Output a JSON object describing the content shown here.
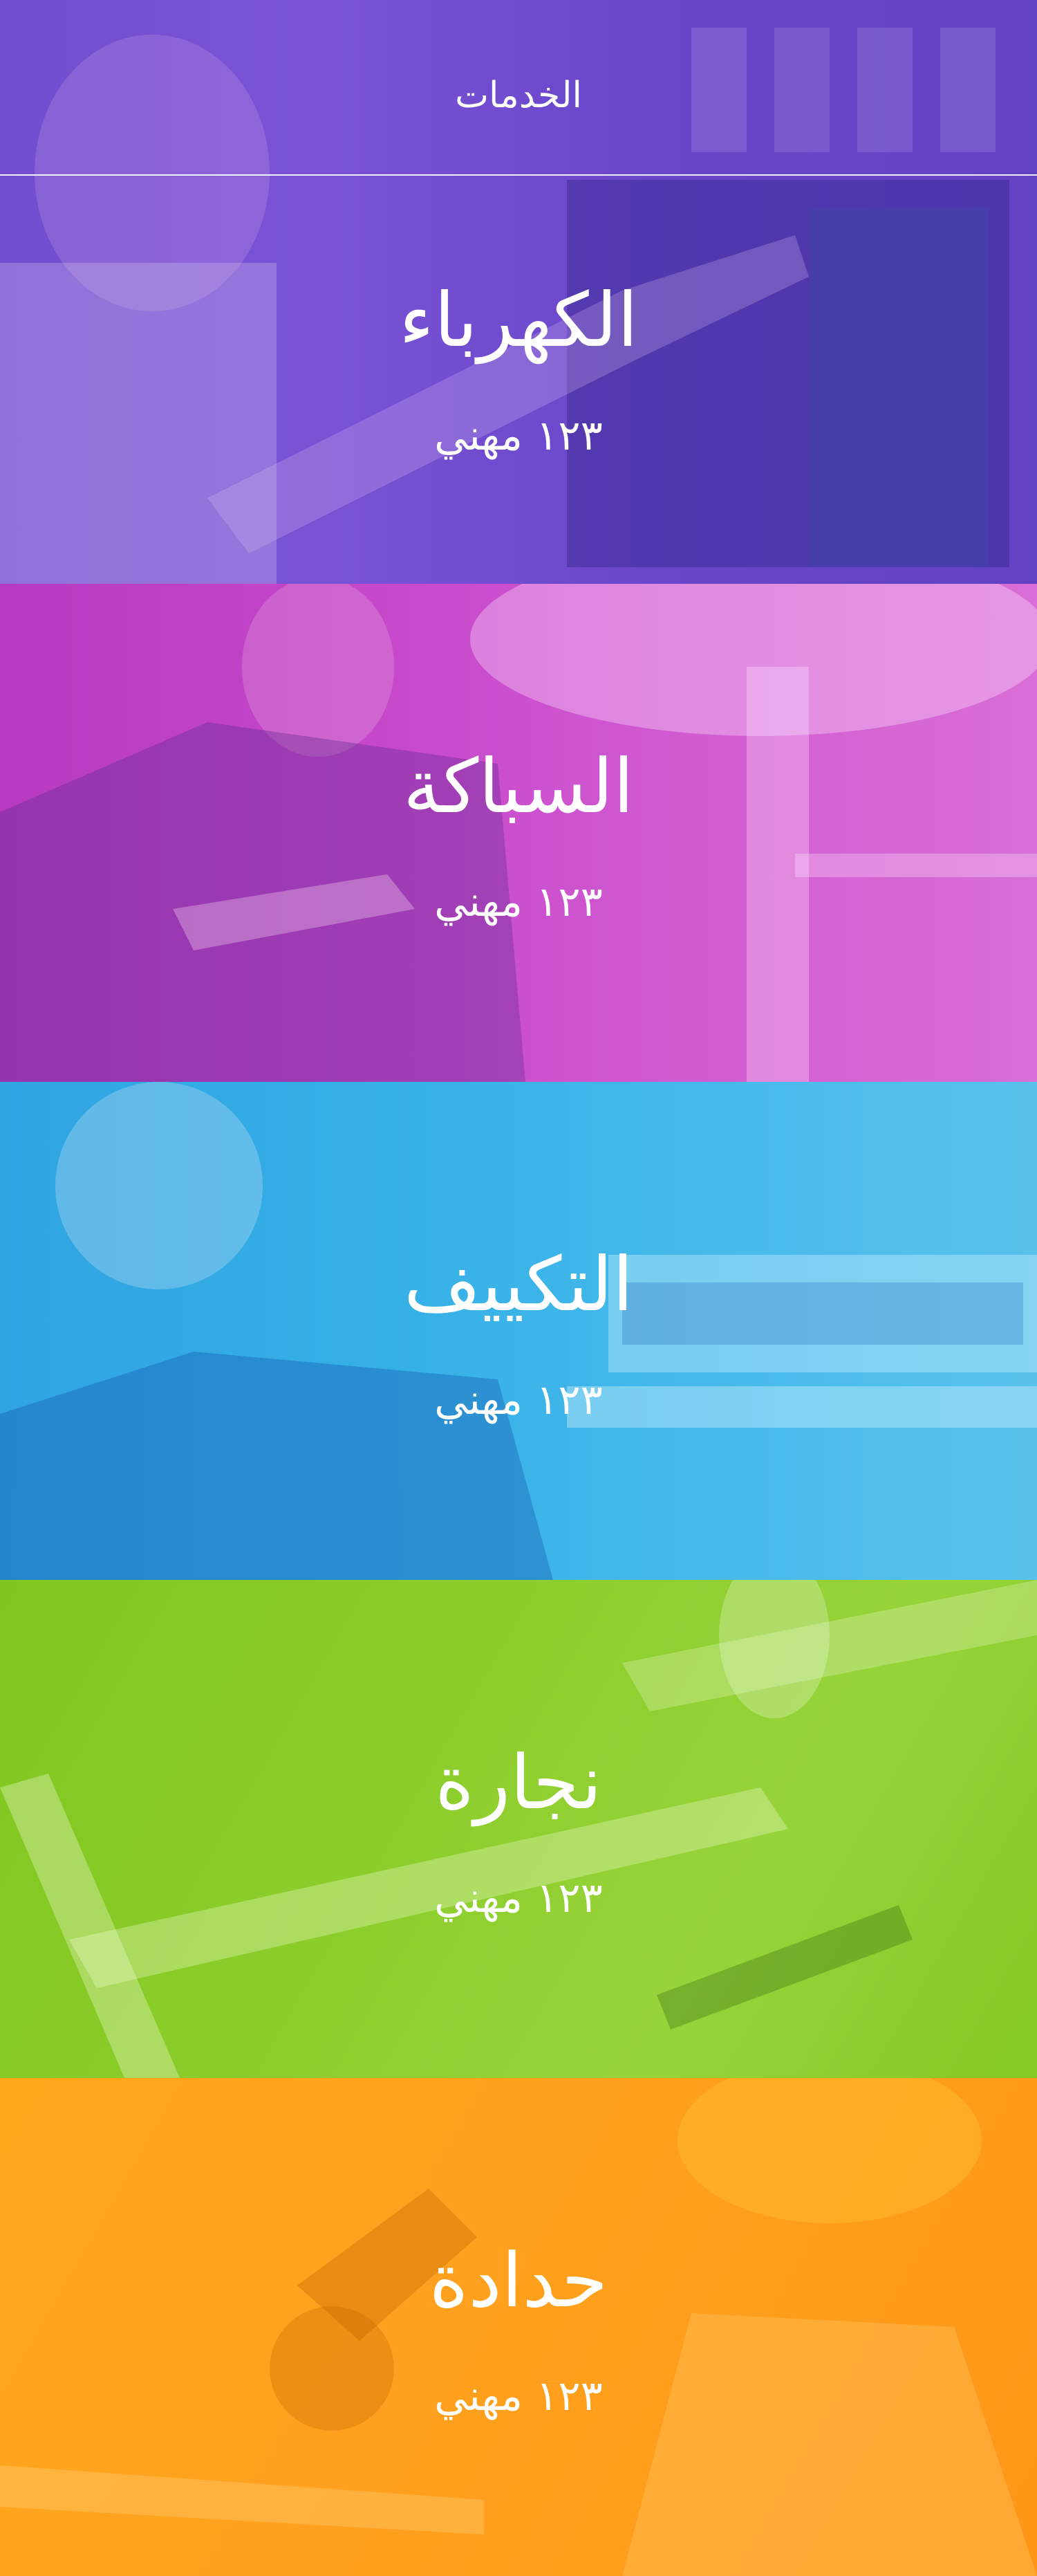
{
  "header": {
    "title": "الخدمات"
  },
  "services": [
    {
      "name": "الكهرباء",
      "count": "١٢٣ مهني",
      "color": "#7a4fd6"
    },
    {
      "name": "السباكة",
      "count": "١٢٣ مهني",
      "color": "#c94ccc"
    },
    {
      "name": "التكييف",
      "count": "١٢٣ مهني",
      "color": "#34b2e8"
    },
    {
      "name": "نجارة",
      "count": "١٢٣ مهني",
      "color": "#84cc22"
    },
    {
      "name": "حدادة",
      "count": "١٢٣ مهني",
      "color": "#ffa01c"
    }
  ]
}
